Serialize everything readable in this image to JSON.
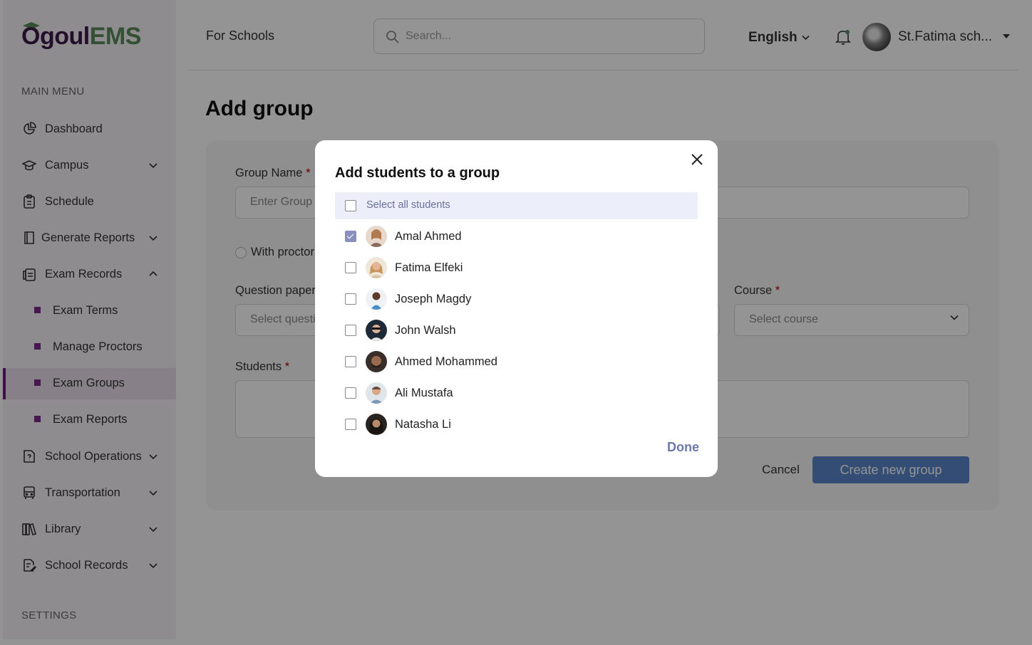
{
  "app": {
    "logo_prefix": "Ogoul",
    "logo_suffix": "EMS",
    "colors": {
      "brand": "#3d1a4d",
      "brand_accent": "#5a8a5a",
      "active_bullet": "#7a2a8a",
      "primary_button": "#5b86c8",
      "done": "#6d79ac"
    }
  },
  "sidebar": {
    "main_menu_heading": "MAIN MENU",
    "settings_heading": "SETTINGS",
    "items": [
      {
        "label": "Dashboard",
        "icon": "pie-chart-icon"
      },
      {
        "label": "Campus",
        "icon": "graduation-cap-icon"
      },
      {
        "label": "Schedule",
        "icon": "clipboard-icon"
      },
      {
        "label": "Generate Reports",
        "icon": "book-icon"
      },
      {
        "label": "Exam Records",
        "icon": "clipboard-list-icon"
      },
      {
        "label": "School Operations",
        "icon": "question-file-icon"
      },
      {
        "label": "Transportation",
        "icon": "bus-icon"
      },
      {
        "label": "Library",
        "icon": "library-icon"
      },
      {
        "label": "School Records",
        "icon": "file-edit-icon"
      }
    ],
    "sub_items": [
      {
        "label": "Exam Terms"
      },
      {
        "label": "Manage Proctors"
      },
      {
        "label": "Exam Groups"
      },
      {
        "label": "Exam Reports"
      }
    ]
  },
  "header": {
    "section_title": "For Schools",
    "search_placeholder": "Search...",
    "language": "English",
    "user_name": "St.Fatima sch..."
  },
  "page": {
    "title": "Add group",
    "group_name_label": "Group Name",
    "group_name_placeholder": "Enter Group",
    "with_proctor_label": "With proctor",
    "question_paper_label": "Question paper",
    "question_paper_placeholder": "Select questi",
    "course_label": "Course",
    "course_placeholder": "Select course",
    "students_label": "Students",
    "required_mark": "*",
    "cancel_label": "Cancel",
    "create_label": "Create new group"
  },
  "modal": {
    "title": "Add students to a group",
    "select_all_label": "Select all students",
    "done_label": "Done",
    "students": [
      {
        "name": "Amal Ahmed",
        "checked": true
      },
      {
        "name": "Fatima Elfeki",
        "checked": false
      },
      {
        "name": "Joseph Magdy",
        "checked": false
      },
      {
        "name": "John Walsh",
        "checked": false
      },
      {
        "name": "Ahmed Mohammed",
        "checked": false
      },
      {
        "name": "Ali Mustafa",
        "checked": false
      },
      {
        "name": "Natasha Li",
        "checked": false
      }
    ]
  }
}
